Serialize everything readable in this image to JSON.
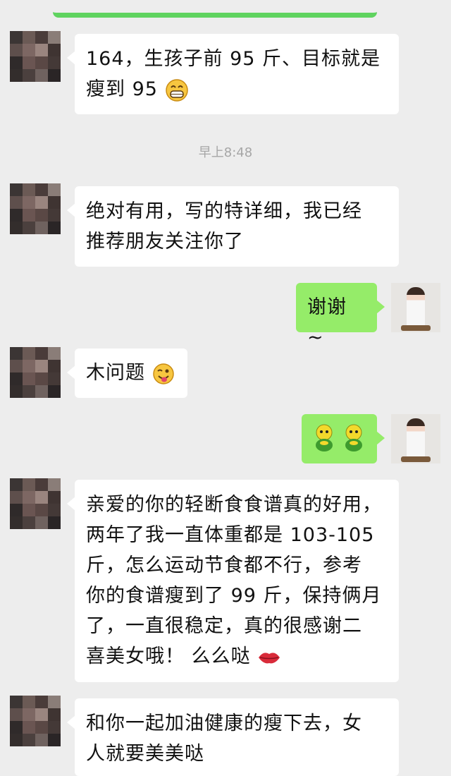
{
  "messages": {
    "m1": {
      "line1": "164，生孩子前 95 斤、目标就是",
      "line2": "瘦到 95"
    },
    "timestamp": "早上8:48",
    "m2": {
      "line1": "绝对有用，写的特详细，我已经",
      "line2": "推荐朋友关注你了"
    },
    "m3": {
      "text": "谢谢 ~"
    },
    "m4": {
      "text": "木问题"
    },
    "m6": {
      "lines": [
        "亲爱的你的轻断食食谱真的好用，",
        "两年了我一直体重都是 103-105",
        "斤，怎么运动节食都不行，参考",
        "你的食谱瘦到了 99 斤，保持俩月",
        "了，一直很稳定，真的很感谢二",
        "喜美女哦！ 么么哒"
      ]
    },
    "m7": {
      "line1": "和你一起加油健康的瘦下去，女",
      "line2": "人就要美美哒"
    }
  },
  "colors": {
    "incoming": "#ffffff",
    "outgoing": "#95ec69",
    "background": "#ededed"
  },
  "icons": [
    "grinning-emoji-icon",
    "winking-tongue-emoji-icon",
    "green-figure-emoji-icon",
    "lips-emoji-icon"
  ]
}
